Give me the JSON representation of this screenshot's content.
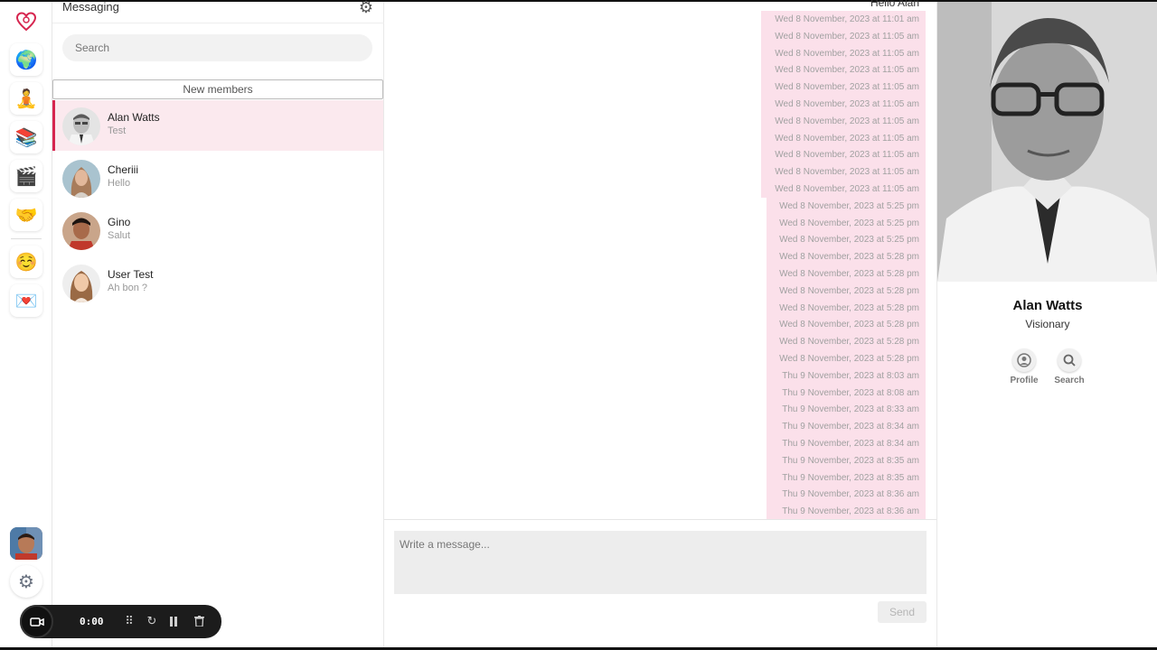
{
  "sidebar": {
    "items": [
      {
        "name": "heart-logo",
        "glyph": "♡"
      },
      {
        "name": "globe",
        "glyph": "🌍"
      },
      {
        "name": "meditation",
        "glyph": "🧘"
      },
      {
        "name": "books",
        "glyph": "📚"
      },
      {
        "name": "clapperboard",
        "glyph": "🎬"
      },
      {
        "name": "handshake",
        "glyph": "🤝"
      },
      {
        "name": "smiling-face",
        "glyph": "☺️"
      },
      {
        "name": "love-letter",
        "glyph": "💌"
      }
    ],
    "settings_glyph": "⚙"
  },
  "conversations": {
    "title": "Messaging",
    "search_placeholder": "Search",
    "new_members_label": "New members",
    "items": [
      {
        "name": "Alan Watts",
        "preview": "Test",
        "active": true
      },
      {
        "name": "Cheriii",
        "preview": "Hello",
        "active": false
      },
      {
        "name": "Gino",
        "preview": "Salut",
        "active": false
      },
      {
        "name": "User Test",
        "preview": "Ah bon ?",
        "active": false
      }
    ]
  },
  "recorder": {
    "time": "0:00"
  },
  "chat": {
    "first_message": "Hello Alan",
    "messages": [
      "Wed 8 November, 2023 at 11:01 am",
      "Wed 8 November, 2023 at 11:05 am",
      "Wed 8 November, 2023 at 11:05 am",
      "Wed 8 November, 2023 at 11:05 am",
      "Wed 8 November, 2023 at 11:05 am",
      "Wed 8 November, 2023 at 11:05 am",
      "Wed 8 November, 2023 at 11:05 am",
      "Wed 8 November, 2023 at 11:05 am",
      "Wed 8 November, 2023 at 11:05 am",
      "Wed 8 November, 2023 at 11:05 am",
      "Wed 8 November, 2023 at 11:05 am",
      "Wed 8 November, 2023 at 5:25 pm",
      "Wed 8 November, 2023 at 5:25 pm",
      "Wed 8 November, 2023 at 5:25 pm",
      "Wed 8 November, 2023 at 5:28 pm",
      "Wed 8 November, 2023 at 5:28 pm",
      "Wed 8 November, 2023 at 5:28 pm",
      "Wed 8 November, 2023 at 5:28 pm",
      "Wed 8 November, 2023 at 5:28 pm",
      "Wed 8 November, 2023 at 5:28 pm",
      "Wed 8 November, 2023 at 5:28 pm",
      "Thu 9 November, 2023 at 8:03 am",
      "Thu 9 November, 2023 at 8:08 am",
      "Thu 9 November, 2023 at 8:33 am",
      "Thu 9 November, 2023 at 8:34 am",
      "Thu 9 November, 2023 at 8:34 am",
      "Thu 9 November, 2023 at 8:35 am",
      "Thu 9 November, 2023 at 8:35 am",
      "Thu 9 November, 2023 at 8:36 am",
      "Thu 9 November, 2023 at 8:36 am"
    ],
    "composer_placeholder": "Write a message...",
    "send_label": "Send"
  },
  "profile": {
    "name": "Alan Watts",
    "role": "Visionary",
    "actions": {
      "profile_label": "Profile",
      "search_label": "Search"
    }
  },
  "colors": {
    "accent": "#d6254f",
    "bubble": "#fbe0ea",
    "active_row": "#fbe9ee"
  }
}
